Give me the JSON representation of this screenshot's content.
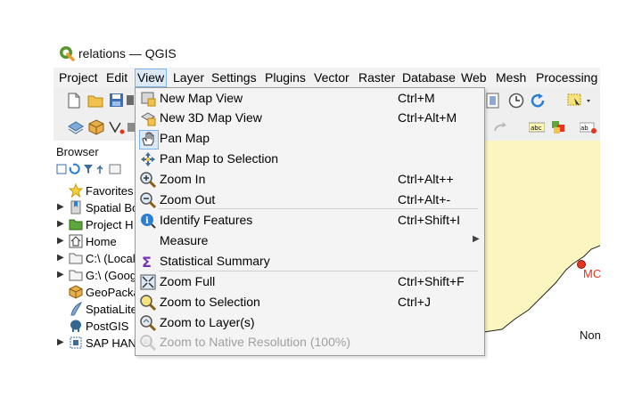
{
  "window": {
    "title": "relations — QGIS"
  },
  "menubar": {
    "items": [
      {
        "label": "Project",
        "active": false
      },
      {
        "label": "Edit",
        "active": false
      },
      {
        "label": "View",
        "active": true
      },
      {
        "label": "Layer",
        "active": false
      },
      {
        "label": "Settings",
        "active": false
      },
      {
        "label": "Plugins",
        "active": false
      },
      {
        "label": "Vector",
        "active": false
      },
      {
        "label": "Raster",
        "active": false
      },
      {
        "label": "Database",
        "active": false
      },
      {
        "label": "Web",
        "active": false
      },
      {
        "label": "Mesh",
        "active": false
      },
      {
        "label": "Processing",
        "active": false
      }
    ]
  },
  "view_menu": {
    "items": [
      {
        "label": "New Map View",
        "shortcut": "Ctrl+M",
        "icon": "new-map-view-icon"
      },
      {
        "label": "New 3D Map View",
        "shortcut": "Ctrl+Alt+M",
        "icon": "new-3d-map-view-icon"
      },
      {
        "label": "Pan Map",
        "shortcut": "",
        "icon": "pan-hand-icon",
        "checked": true
      },
      {
        "label": "Pan Map to Selection",
        "shortcut": "",
        "icon": "pan-to-selection-icon"
      },
      {
        "label": "Zoom In",
        "shortcut": "Ctrl+Alt++",
        "icon": "zoom-in-icon"
      },
      {
        "label": "Zoom Out",
        "shortcut": "Ctrl+Alt+-",
        "icon": "zoom-out-icon"
      },
      {
        "label": "Identify Features",
        "shortcut": "Ctrl+Shift+I",
        "icon": "identify-icon"
      },
      {
        "label": "Measure",
        "shortcut": "",
        "icon": "",
        "submenu": true
      },
      {
        "label": "Statistical Summary",
        "shortcut": "",
        "icon": "sigma-icon"
      },
      {
        "label": "Zoom Full",
        "shortcut": "Ctrl+Shift+F",
        "icon": "zoom-full-icon"
      },
      {
        "label": "Zoom to Selection",
        "shortcut": "Ctrl+J",
        "icon": "zoom-to-selection-icon"
      },
      {
        "label": "Zoom to Layer(s)",
        "shortcut": "",
        "icon": "zoom-to-layer-icon"
      },
      {
        "label": "Zoom to Native Resolution (100%)",
        "shortcut": "",
        "icon": "zoom-native-icon",
        "disabled": true
      }
    ]
  },
  "browser": {
    "title": "Browser",
    "items": [
      {
        "label": "Favorites",
        "icon": "star-icon",
        "expandable": false
      },
      {
        "label": "Spatial Bo",
        "icon": "spatial-bookmarks-icon",
        "expandable": true
      },
      {
        "label": "Project H",
        "icon": "project-home-icon",
        "expandable": true
      },
      {
        "label": "Home",
        "icon": "home-icon",
        "expandable": true
      },
      {
        "label": "C:\\ (Local",
        "icon": "drive-icon",
        "expandable": true
      },
      {
        "label": "G:\\ (Goog",
        "icon": "drive-icon",
        "expandable": true
      },
      {
        "label": "GeoPacka",
        "icon": "geopackage-icon",
        "expandable": false
      },
      {
        "label": "SpatiaLite",
        "icon": "spatialite-icon",
        "expandable": false
      },
      {
        "label": "PostGIS",
        "icon": "postgis-icon",
        "expandable": false
      },
      {
        "label": "SAP HAN",
        "icon": "sap-hana-icon",
        "expandable": true
      }
    ]
  },
  "map": {
    "labels": [
      "MC",
      "Non"
    ],
    "land_color": "#fbf6c0",
    "point_color": "#e8341c"
  },
  "colors": {
    "menu_highlight": "#dbe9f7",
    "menu_highlight_border": "#7eb4ea"
  }
}
